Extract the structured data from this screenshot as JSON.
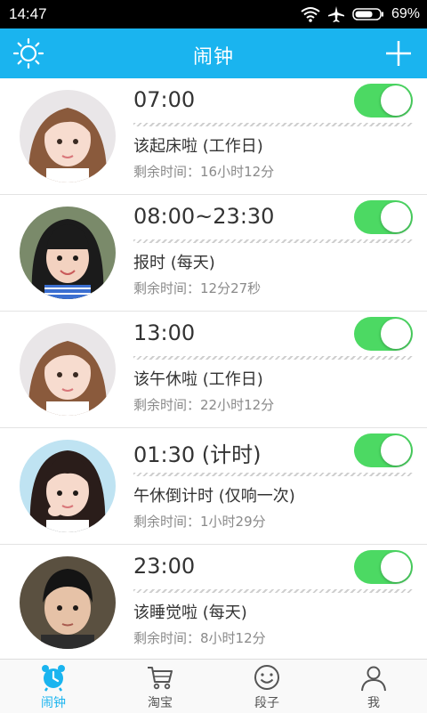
{
  "status_bar": {
    "time": "14:47",
    "battery": "69%"
  },
  "header": {
    "title": "闹钟"
  },
  "alarms": [
    {
      "time": "07:00",
      "label": "该起床啦 (工作日)",
      "remaining": "剩余时间：16小时12分",
      "enabled": true
    },
    {
      "time": "08:00~23:30",
      "label": "报时 (每天)",
      "remaining": "剩余时间：12分27秒",
      "enabled": true
    },
    {
      "time": "13:00",
      "label": "该午休啦 (工作日)",
      "remaining": "剩余时间：22小时12分",
      "enabled": true
    },
    {
      "time": "01:30 (计时)",
      "label": "午休倒计时 (仅响一次)",
      "remaining": "剩余时间：1小时29分",
      "enabled": true
    },
    {
      "time": "23:00",
      "label": "该睡觉啦 (每天)",
      "remaining": "剩余时间：8小时12分",
      "enabled": true
    }
  ],
  "bottom_nav": {
    "items": [
      {
        "label": "闹钟",
        "icon": "alarm-clock-icon",
        "active": true
      },
      {
        "label": "淘宝",
        "icon": "shopping-cart-icon",
        "active": false
      },
      {
        "label": "段子",
        "icon": "smiley-icon",
        "active": false
      },
      {
        "label": "我",
        "icon": "person-icon",
        "active": false
      }
    ]
  },
  "colors": {
    "accent": "#1ab4ef",
    "toggle_on": "#4cd963",
    "text": "#333333",
    "subtext": "#8a8a8a"
  }
}
